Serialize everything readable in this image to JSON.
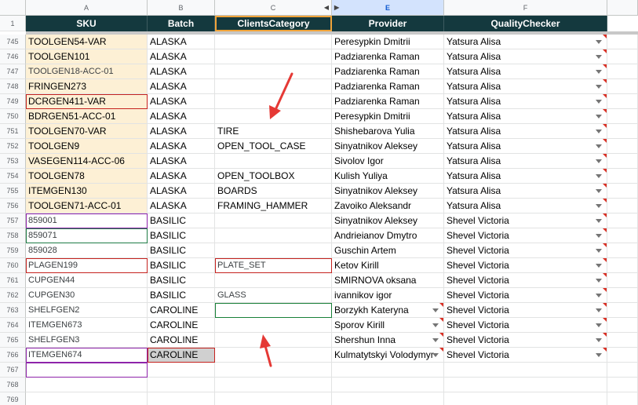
{
  "columns": [
    {
      "letter": "A",
      "selected": false
    },
    {
      "letter": "B",
      "selected": false
    },
    {
      "letter": "C",
      "selected": false
    },
    {
      "letter": "E",
      "selected": true
    },
    {
      "letter": "F",
      "selected": false
    }
  ],
  "header_row_number": "1",
  "headers": {
    "sku": "SKU",
    "batch": "Batch",
    "clients_category": "ClientsCategory",
    "provider": "Provider",
    "quality_checker": "QualityChecker"
  },
  "rows": [
    {
      "num": "745",
      "sku": "TOOLGEN54-VAR",
      "batch": "ALASKA",
      "category": "",
      "provider": "Peresypkin Dmitrii",
      "checker": "Yatsura Alisa"
    },
    {
      "num": "746",
      "sku": "TOOLGEN101",
      "batch": "ALASKA",
      "category": "",
      "provider": "Padziarenka Raman",
      "checker": "Yatsura Alisa"
    },
    {
      "num": "747",
      "sku": "TOOLGEN18-ACC-01",
      "batch": "ALASKA",
      "category": "",
      "provider": "Padziarenka Raman",
      "checker": "Yatsura Alisa"
    },
    {
      "num": "748",
      "sku": "FRINGEN273",
      "batch": "ALASKA",
      "category": "",
      "provider": "Padziarenka Raman",
      "checker": "Yatsura Alisa"
    },
    {
      "num": "749",
      "sku": "DCRGEN411-VAR",
      "batch": "ALASKA",
      "category": "",
      "provider": "Padziarenka Raman",
      "checker": "Yatsura Alisa"
    },
    {
      "num": "750",
      "sku": "BDRGEN51-ACC-01",
      "batch": "ALASKA",
      "category": "",
      "provider": "Peresypkin Dmitrii",
      "checker": "Yatsura Alisa"
    },
    {
      "num": "751",
      "sku": "TOOLGEN70-VAR",
      "batch": "ALASKA",
      "category": "TIRE",
      "provider": "Shishebarova Yulia",
      "checker": "Yatsura Alisa"
    },
    {
      "num": "752",
      "sku": "TOOLGEN9",
      "batch": "ALASKA",
      "category": "OPEN_TOOL_CASE",
      "provider": "Sinyatnikov Aleksey",
      "checker": "Yatsura Alisa"
    },
    {
      "num": "753",
      "sku": "VASEGEN114-ACC-06",
      "batch": "ALASKA",
      "category": "",
      "provider": "Sivolov Igor",
      "checker": "Yatsura Alisa"
    },
    {
      "num": "754",
      "sku": "TOOLGEN78",
      "batch": "ALASKA",
      "category": "OPEN_TOOLBOX",
      "provider": "Kulish Yuliya",
      "checker": "Yatsura Alisa"
    },
    {
      "num": "755",
      "sku": "ITEMGEN130",
      "batch": "ALASKA",
      "category": "BOARDS",
      "provider": "Sinyatnikov Aleksey",
      "checker": "Yatsura Alisa"
    },
    {
      "num": "756",
      "sku": "TOOLGEN71-ACC-01",
      "batch": "ALASKA",
      "category": "FRAMING_HAMMER",
      "provider": "Zavoiko Aleksandr",
      "checker": "Yatsura Alisa"
    },
    {
      "num": "757",
      "sku": "859001",
      "batch": "BASILIC",
      "category": "",
      "provider": "Sinyatnikov Aleksey",
      "checker": "Shevel Victoria"
    },
    {
      "num": "758",
      "sku": "859071",
      "batch": "BASILIC",
      "category": "",
      "provider": "Andrieianov Dmytro",
      "checker": "Shevel Victoria"
    },
    {
      "num": "759",
      "sku": "859028",
      "batch": "BASILIC",
      "category": "",
      "provider": "Guschin Artem",
      "checker": "Shevel Victoria"
    },
    {
      "num": "760",
      "sku": "PLAGEN199",
      "batch": "BASILIC",
      "category": "PLATE_SET",
      "provider": "Ketov Kirill",
      "checker": "Shevel Victoria"
    },
    {
      "num": "761",
      "sku": "CUPGEN44",
      "batch": "BASILIC",
      "category": "",
      "provider": "SMIRNOVA oksana",
      "checker": "Shevel Victoria"
    },
    {
      "num": "762",
      "sku": "CUPGEN30",
      "batch": "BASILIC",
      "category": "GLASS",
      "provider": "ivannikov igor",
      "checker": "Shevel Victoria"
    },
    {
      "num": "763",
      "sku": "SHELFGEN2",
      "batch": "CAROLINE",
      "category": "",
      "provider": "Borzykh Kateryna",
      "checker": "Shevel Victoria"
    },
    {
      "num": "764",
      "sku": "ITEMGEN673",
      "batch": "CAROLINE",
      "category": "",
      "provider": "Sporov Kirill",
      "checker": "Shevel Victoria"
    },
    {
      "num": "765",
      "sku": "SHELFGEN3",
      "batch": "CAROLINE",
      "category": "",
      "provider": "Shershun Inna",
      "checker": "Shevel Victoria"
    },
    {
      "num": "766",
      "sku": "ITEMGEN674",
      "batch": "CAROLINE",
      "category": "",
      "provider": "Kulmatytskyi Volodymyr",
      "checker": "Shevel Victoria"
    },
    {
      "num": "767",
      "sku": "",
      "batch": "",
      "category": "",
      "provider": "",
      "checker": ""
    },
    {
      "num": "768",
      "sku": "",
      "batch": "",
      "category": "",
      "provider": "",
      "checker": ""
    },
    {
      "num": "769",
      "sku": "",
      "batch": "",
      "category": "",
      "provider": "",
      "checker": ""
    }
  ],
  "colors": {
    "header_bg": "#14393e",
    "sku_highlight": "#fdf0d5",
    "annotation_arrow": "#e53935",
    "selected_column": "#d3e3fd"
  },
  "annotations": [
    "red-arrow",
    "red-arrow"
  ]
}
